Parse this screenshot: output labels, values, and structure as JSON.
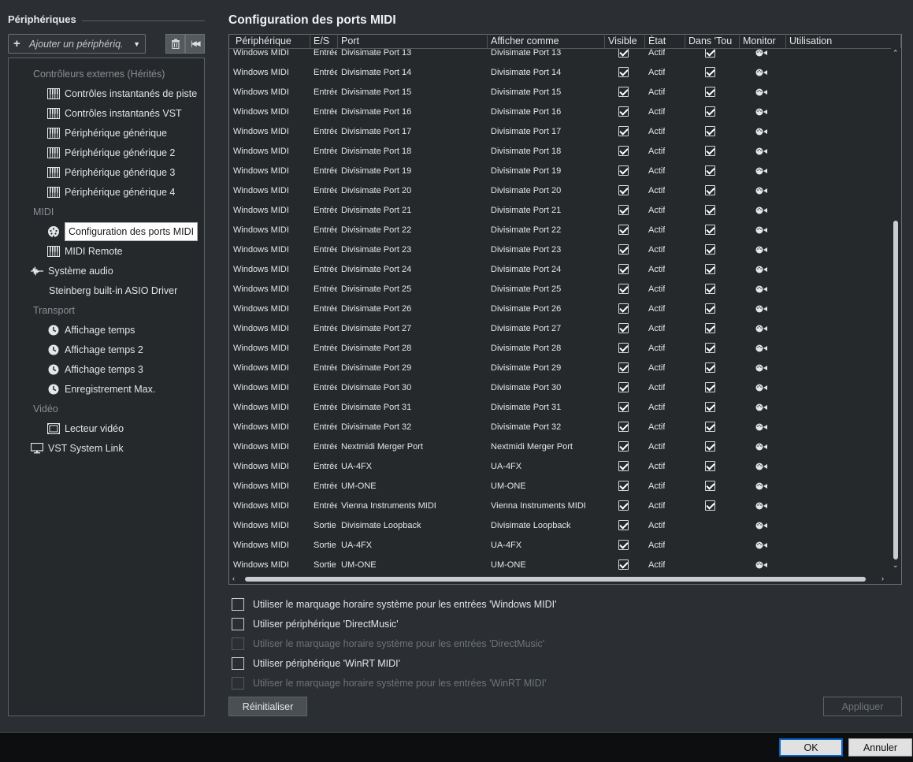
{
  "left": {
    "title": "Périphériques",
    "add_device_label": "Ajouter un périphériq.",
    "tree": [
      {
        "label": "Contrôleurs externes (Hérités)",
        "kind": "category",
        "indent": 1
      },
      {
        "label": "Contrôles instantanés de piste",
        "icon": "midi-keyboard-icon",
        "indent": 2
      },
      {
        "label": "Contrôles instantanés VST",
        "icon": "midi-keyboard-icon",
        "indent": 2
      },
      {
        "label": "Périphérique générique",
        "icon": "midi-keyboard-icon",
        "indent": 2
      },
      {
        "label": "Périphérique générique 2",
        "icon": "midi-keyboard-icon",
        "indent": 2
      },
      {
        "label": "Périphérique générique 3",
        "icon": "midi-keyboard-icon",
        "indent": 2
      },
      {
        "label": "Périphérique générique 4",
        "icon": "midi-keyboard-icon",
        "indent": 2
      },
      {
        "label": "MIDI",
        "kind": "category",
        "indent": 1
      },
      {
        "label": "Configuration des ports MIDI",
        "icon": "midi-port-icon",
        "indent": 2,
        "selected": true
      },
      {
        "label": "MIDI Remote",
        "icon": "midi-keyboard-icon",
        "indent": 2
      },
      {
        "label": "Système audio",
        "icon": "audio-wave-icon",
        "indent": 1
      },
      {
        "label": "Steinberg built-in ASIO Driver",
        "indent": 2
      },
      {
        "label": "Transport",
        "kind": "category",
        "indent": 1
      },
      {
        "label": "Affichage temps",
        "icon": "clock-icon",
        "indent": 2
      },
      {
        "label": "Affichage temps 2",
        "icon": "clock-icon",
        "indent": 2
      },
      {
        "label": "Affichage temps 3",
        "icon": "clock-icon",
        "indent": 2
      },
      {
        "label": "Enregistrement Max.",
        "icon": "clock-icon",
        "indent": 2
      },
      {
        "label": "Vidéo",
        "kind": "category",
        "indent": 1
      },
      {
        "label": "Lecteur vidéo",
        "icon": "film-icon",
        "indent": 2
      },
      {
        "label": "VST System Link",
        "icon": "monitor-icon",
        "indent": 0
      }
    ]
  },
  "right": {
    "title": "Configuration des ports MIDI",
    "columns": [
      "Périphérique",
      "E/S",
      "Port",
      "Afficher comme",
      "Visible",
      "État",
      "Dans 'Tou",
      "Monitor",
      "Utilisation"
    ],
    "rows": [
      {
        "device": "Windows MIDI",
        "io": "Entrée",
        "port": "Divisimate Port 13",
        "show_as": "Divisimate Port 13",
        "visible": true,
        "state": "Actif",
        "in_all": true
      },
      {
        "device": "Windows MIDI",
        "io": "Entrée",
        "port": "Divisimate Port 14",
        "show_as": "Divisimate Port 14",
        "visible": true,
        "state": "Actif",
        "in_all": true
      },
      {
        "device": "Windows MIDI",
        "io": "Entrée",
        "port": "Divisimate Port 15",
        "show_as": "Divisimate Port 15",
        "visible": true,
        "state": "Actif",
        "in_all": true
      },
      {
        "device": "Windows MIDI",
        "io": "Entrée",
        "port": "Divisimate Port 16",
        "show_as": "Divisimate Port 16",
        "visible": true,
        "state": "Actif",
        "in_all": true
      },
      {
        "device": "Windows MIDI",
        "io": "Entrée",
        "port": "Divisimate Port 17",
        "show_as": "Divisimate Port 17",
        "visible": true,
        "state": "Actif",
        "in_all": true
      },
      {
        "device": "Windows MIDI",
        "io": "Entrée",
        "port": "Divisimate Port 18",
        "show_as": "Divisimate Port 18",
        "visible": true,
        "state": "Actif",
        "in_all": true
      },
      {
        "device": "Windows MIDI",
        "io": "Entrée",
        "port": "Divisimate Port 19",
        "show_as": "Divisimate Port 19",
        "visible": true,
        "state": "Actif",
        "in_all": true
      },
      {
        "device": "Windows MIDI",
        "io": "Entrée",
        "port": "Divisimate Port 20",
        "show_as": "Divisimate Port 20",
        "visible": true,
        "state": "Actif",
        "in_all": true
      },
      {
        "device": "Windows MIDI",
        "io": "Entrée",
        "port": "Divisimate Port 21",
        "show_as": "Divisimate Port 21",
        "visible": true,
        "state": "Actif",
        "in_all": true
      },
      {
        "device": "Windows MIDI",
        "io": "Entrée",
        "port": "Divisimate Port 22",
        "show_as": "Divisimate Port 22",
        "visible": true,
        "state": "Actif",
        "in_all": true
      },
      {
        "device": "Windows MIDI",
        "io": "Entrée",
        "port": "Divisimate Port 23",
        "show_as": "Divisimate Port 23",
        "visible": true,
        "state": "Actif",
        "in_all": true
      },
      {
        "device": "Windows MIDI",
        "io": "Entrée",
        "port": "Divisimate Port 24",
        "show_as": "Divisimate Port 24",
        "visible": true,
        "state": "Actif",
        "in_all": true
      },
      {
        "device": "Windows MIDI",
        "io": "Entrée",
        "port": "Divisimate Port 25",
        "show_as": "Divisimate Port 25",
        "visible": true,
        "state": "Actif",
        "in_all": true
      },
      {
        "device": "Windows MIDI",
        "io": "Entrée",
        "port": "Divisimate Port 26",
        "show_as": "Divisimate Port 26",
        "visible": true,
        "state": "Actif",
        "in_all": true
      },
      {
        "device": "Windows MIDI",
        "io": "Entrée",
        "port": "Divisimate Port 27",
        "show_as": "Divisimate Port 27",
        "visible": true,
        "state": "Actif",
        "in_all": true
      },
      {
        "device": "Windows MIDI",
        "io": "Entrée",
        "port": "Divisimate Port 28",
        "show_as": "Divisimate Port 28",
        "visible": true,
        "state": "Actif",
        "in_all": true
      },
      {
        "device": "Windows MIDI",
        "io": "Entrée",
        "port": "Divisimate Port 29",
        "show_as": "Divisimate Port 29",
        "visible": true,
        "state": "Actif",
        "in_all": true
      },
      {
        "device": "Windows MIDI",
        "io": "Entrée",
        "port": "Divisimate Port 30",
        "show_as": "Divisimate Port 30",
        "visible": true,
        "state": "Actif",
        "in_all": true
      },
      {
        "device": "Windows MIDI",
        "io": "Entrée",
        "port": "Divisimate Port 31",
        "show_as": "Divisimate Port 31",
        "visible": true,
        "state": "Actif",
        "in_all": true
      },
      {
        "device": "Windows MIDI",
        "io": "Entrée",
        "port": "Divisimate Port 32",
        "show_as": "Divisimate Port 32",
        "visible": true,
        "state": "Actif",
        "in_all": true
      },
      {
        "device": "Windows MIDI",
        "io": "Entrée",
        "port": "Nextmidi Merger Port",
        "show_as": "Nextmidi Merger Port",
        "visible": true,
        "state": "Actif",
        "in_all": true
      },
      {
        "device": "Windows MIDI",
        "io": "Entrée",
        "port": "UA-4FX",
        "show_as": "UA-4FX",
        "visible": true,
        "state": "Actif",
        "in_all": true
      },
      {
        "device": "Windows MIDI",
        "io": "Entrée",
        "port": "UM-ONE",
        "show_as": "UM-ONE",
        "visible": true,
        "state": "Actif",
        "in_all": true
      },
      {
        "device": "Windows MIDI",
        "io": "Entrée",
        "port": "Vienna Instruments MIDI",
        "show_as": "Vienna Instruments MIDI",
        "visible": true,
        "state": "Actif",
        "in_all": true
      },
      {
        "device": "Windows MIDI",
        "io": "Sortie",
        "port": "Divisimate Loopback",
        "show_as": "Divisimate Loopback",
        "visible": true,
        "state": "Actif",
        "in_all": null
      },
      {
        "device": "Windows MIDI",
        "io": "Sortie",
        "port": "UA-4FX",
        "show_as": "UA-4FX",
        "visible": true,
        "state": "Actif",
        "in_all": null
      },
      {
        "device": "Windows MIDI",
        "io": "Sortie",
        "port": "UM-ONE",
        "show_as": "UM-ONE",
        "visible": true,
        "state": "Actif",
        "in_all": null
      }
    ],
    "options": [
      {
        "label": "Utiliser le marquage horaire système pour les entrées 'Windows MIDI'",
        "enabled": true,
        "checked": false
      },
      {
        "label": "Utiliser périphérique 'DirectMusic'",
        "enabled": true,
        "checked": false
      },
      {
        "label": "Utiliser le marquage horaire système pour les entrées 'DirectMusic'",
        "enabled": false,
        "checked": false
      },
      {
        "label": "Utiliser périphérique 'WinRT MIDI'",
        "enabled": true,
        "checked": false
      },
      {
        "label": "Utiliser le marquage horaire système pour les entrées 'WinRT MIDI'",
        "enabled": false,
        "checked": false
      }
    ],
    "reset_label": "Réinitialiser",
    "apply_label": "Appliquer"
  },
  "footer": {
    "ok_label": "OK",
    "cancel_label": "Annuler"
  }
}
